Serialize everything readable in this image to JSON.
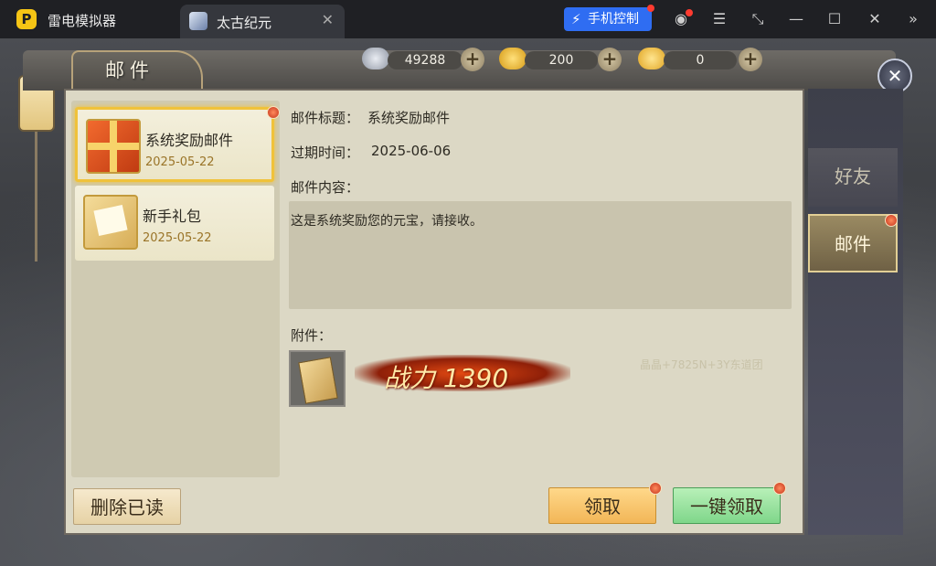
{
  "emulator": {
    "app_title": "雷电模拟器",
    "tab_title": "太古纪元",
    "phone_control_label": "手机控制",
    "accent_color": "#2f6df2"
  },
  "currencies": [
    {
      "name": "silver-ingot-icon",
      "value": "49288"
    },
    {
      "name": "gold-ingot-icon",
      "value": "200"
    },
    {
      "name": "yuanbao-icon",
      "value": "0"
    }
  ],
  "window": {
    "title": "邮件"
  },
  "mail_list": [
    {
      "name": "系统奖励邮件",
      "date": "2025-05-22",
      "icon": "gift-box-icon",
      "selected": true
    },
    {
      "name": "新手礼包",
      "date": "2025-05-22",
      "icon": "envelope-icon",
      "selected": false
    }
  ],
  "detail": {
    "subject_label": "邮件标题：",
    "subject": "系统奖励邮件",
    "expire_label": "过期时间：",
    "expire": "2025-06-06",
    "content_label": "邮件内容：",
    "content": "这是系统奖励您的元宝，请接收。",
    "attachment_label": "附件：",
    "power_text": "战力 1390",
    "faint_text": "晶晶+7825N+3Y东道团"
  },
  "buttons": {
    "delete_read": "删除已读",
    "claim": "领取",
    "claim_all": "一键领取"
  },
  "side_tabs": [
    {
      "label": "好友",
      "active": false
    },
    {
      "label": "邮件",
      "active": true
    }
  ]
}
